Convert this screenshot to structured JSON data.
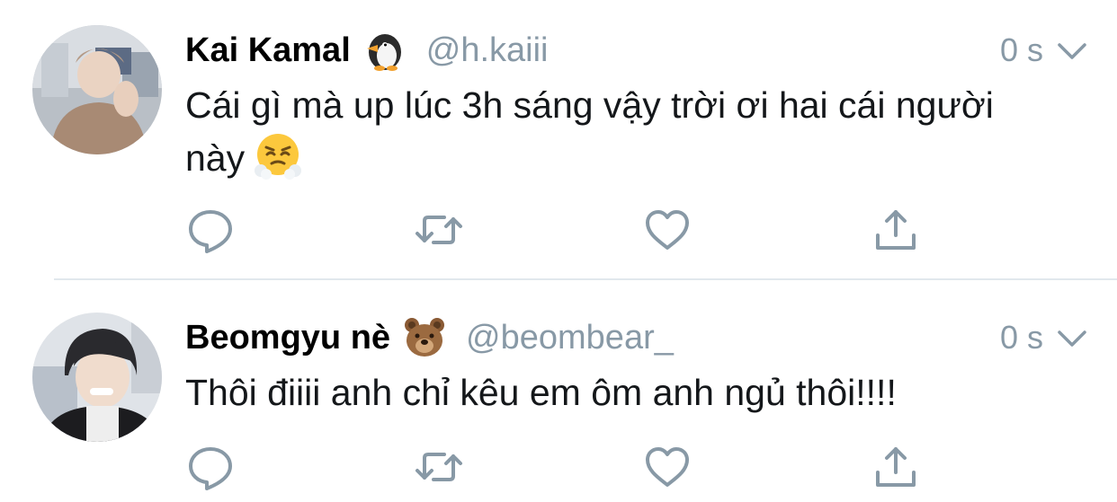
{
  "colors": {
    "name": "#000000",
    "secondary": "#8899a6",
    "text": "#14171a",
    "icon": "#8899a6",
    "divider": "#e1e8ed"
  },
  "tweets": [
    {
      "display_name": "Kai Kamal",
      "name_emoji": "penguin-icon",
      "handle": "@h.kaiii",
      "time": "0 s",
      "text": "Cái gì mà up lúc 3h sáng vậy trời ơi hai cái người này",
      "text_emoji": "steam-face-icon"
    },
    {
      "display_name": "Beomgyu nè",
      "name_emoji": "bear-face-icon",
      "handle": "@beombear_",
      "time": "0 s",
      "text": "Thôi điiii anh chỉ kêu em ôm anh ngủ thôi!!!!",
      "text_emoji": ""
    }
  ],
  "actions": [
    "reply-icon",
    "retweet-icon",
    "like-icon",
    "share-icon"
  ]
}
